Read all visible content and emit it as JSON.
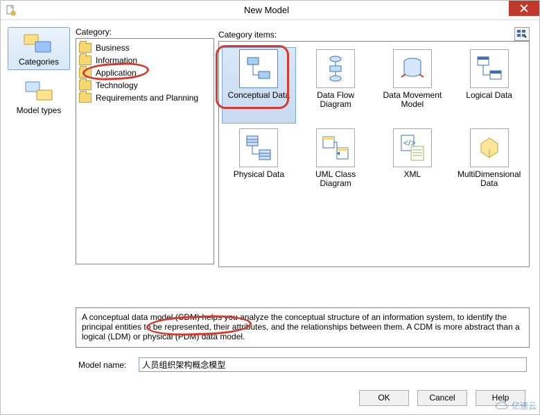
{
  "window": {
    "title": "New Model"
  },
  "outlookbar": {
    "items": [
      {
        "label": "Categories",
        "selected": true
      },
      {
        "label": "Model types",
        "selected": false
      }
    ]
  },
  "category": {
    "label": "Category:",
    "items": [
      {
        "label": "Business"
      },
      {
        "label": "Information",
        "selected": true
      },
      {
        "label": "Application"
      },
      {
        "label": "Technology"
      },
      {
        "label": "Requirements and Planning"
      }
    ]
  },
  "category_items": {
    "label": "Category items:",
    "view_icon": "large-icons",
    "items": [
      {
        "label": "Conceptual Data",
        "selected": true
      },
      {
        "label": "Data Flow Diagram"
      },
      {
        "label": "Data Movement Model"
      },
      {
        "label": "Logical Data"
      },
      {
        "label": "Physical Data"
      },
      {
        "label": "UML Class Diagram"
      },
      {
        "label": "XML"
      },
      {
        "label": "MultiDimensional Data"
      }
    ]
  },
  "description": "A conceptual data model (CDM) helps you analyze the conceptual structure of an information system, to identify the principal entities to be represented, their attributes, and the relationships between them. A CDM is more abstract than a logical (LDM) or physical (PDM) data model.",
  "model_name": {
    "label": "Model name:",
    "value": "人员组织架构概念模型"
  },
  "buttons": {
    "ok": "OK",
    "cancel": "Cancel",
    "help": "Help"
  },
  "watermark": "亿速云"
}
